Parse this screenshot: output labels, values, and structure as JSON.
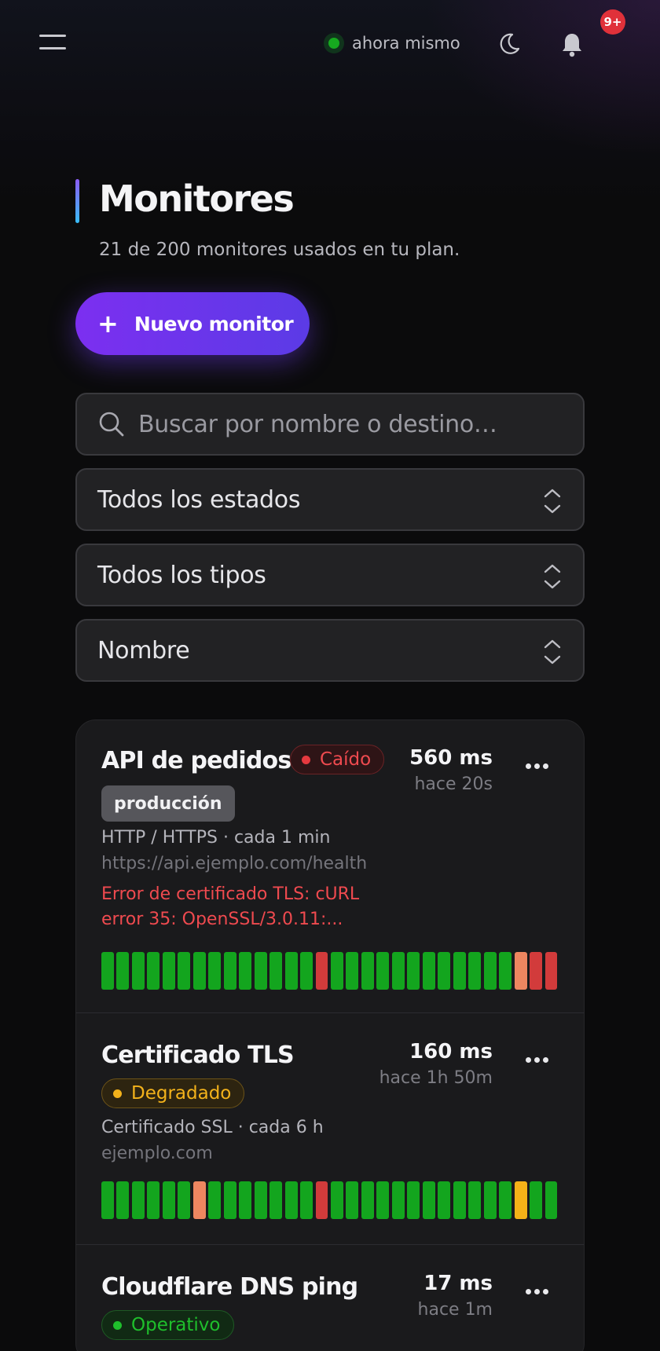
{
  "colors": {
    "ok": "#13a51e",
    "down": "#d23b3b",
    "warn": "#ee8660",
    "degraded": "#f4b218",
    "accent_start": "#7c2ff0",
    "accent_end": "#5b3be6"
  },
  "topbar": {
    "menu_icon": "menu-icon",
    "status_text": "ahora mismo",
    "theme_icon": "moon-icon",
    "bell_icon": "bell-icon",
    "notifications_badge": "9+"
  },
  "header": {
    "title": "Monitores",
    "subtitle": "21 de 200 monitores usados en tu plan.",
    "new_button_icon": "+",
    "new_button_label": "Nuevo monitor"
  },
  "filters": {
    "search_placeholder": "Buscar por nombre o destino…",
    "search_value": "",
    "status_selected": "Todos los estados",
    "type_selected": "Todos los tipos",
    "sort_selected": "Nombre"
  },
  "monitors": [
    {
      "name": "API de pedidos",
      "status": "Caído",
      "status_kind": "down",
      "tag": "producción",
      "response_time": "560 ms",
      "last_check": "hace 20s",
      "meta": "HTTP / HTTPS · cada 1 min",
      "target": "https://api.ejemplo.com/health",
      "error_line1": "Error de certificado TLS: cURL",
      "error_line2": "error 35: OpenSSL/3.0.11:...",
      "history": [
        "ok",
        "ok",
        "ok",
        "ok",
        "ok",
        "ok",
        "ok",
        "ok",
        "ok",
        "ok",
        "ok",
        "ok",
        "ok",
        "ok",
        "down",
        "ok",
        "ok",
        "ok",
        "ok",
        "ok",
        "ok",
        "ok",
        "ok",
        "ok",
        "ok",
        "ok",
        "ok",
        "warn",
        "down",
        "down"
      ]
    },
    {
      "name": "Certificado TLS",
      "status": "Degradado",
      "status_kind": "degraded",
      "response_time": "160 ms",
      "last_check": "hace 1h 50m",
      "meta": "Certificado SSL · cada 6 h",
      "target": "ejemplo.com",
      "history": [
        "ok",
        "ok",
        "ok",
        "ok",
        "ok",
        "ok",
        "warn",
        "ok",
        "ok",
        "ok",
        "ok",
        "ok",
        "ok",
        "ok",
        "down",
        "ok",
        "ok",
        "ok",
        "ok",
        "ok",
        "ok",
        "ok",
        "ok",
        "ok",
        "ok",
        "ok",
        "ok",
        "degraded",
        "ok",
        "ok"
      ]
    },
    {
      "name": "Cloudflare DNS ping",
      "status": "Operativo",
      "status_kind": "ok",
      "response_time": "17 ms",
      "last_check": "hace 1m"
    }
  ]
}
